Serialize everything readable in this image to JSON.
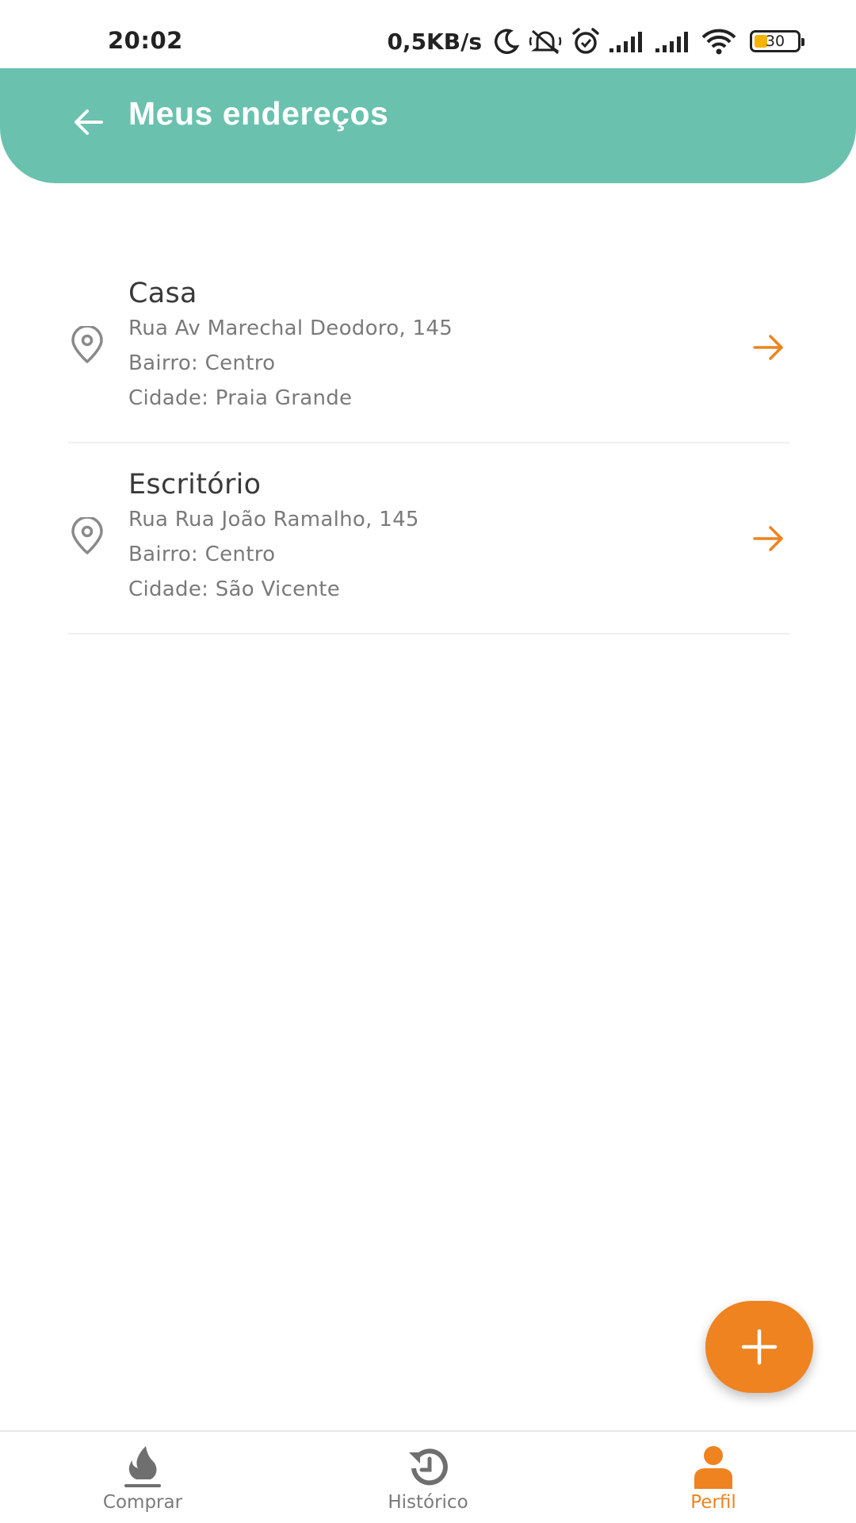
{
  "status_bar": {
    "time": "20:02",
    "net_speed": "0,5KB/s",
    "battery": "30",
    "battery_level_percent": 30,
    "icons": [
      "moon-icon",
      "mute-icon",
      "alarm-icon",
      "signal-icon",
      "signal-icon",
      "wifi-icon",
      "battery-icon"
    ]
  },
  "header": {
    "title": "Meus endereços",
    "back_icon": "arrow-left-icon",
    "color": "#6ac1ae"
  },
  "addresses": [
    {
      "name": "Casa",
      "street": "Rua Av Marechal Deodoro, 145",
      "district": "Bairro: Centro",
      "city": "Cidade: Praia Grande"
    },
    {
      "name": "Escritório",
      "street": "Rua Rua João Ramalho, 145",
      "district": "Bairro: Centro",
      "city": "Cidade: São Vicente"
    }
  ],
  "fab": {
    "icon": "plus-icon",
    "color": "#ee831f"
  },
  "bottom_nav": {
    "items": [
      {
        "label": "Comprar",
        "icon": "flame-icon"
      },
      {
        "label": "Histórico",
        "icon": "history-icon"
      },
      {
        "label": "Perfil",
        "icon": "user-icon",
        "active": true
      }
    ],
    "active_color": "#ee831f"
  }
}
